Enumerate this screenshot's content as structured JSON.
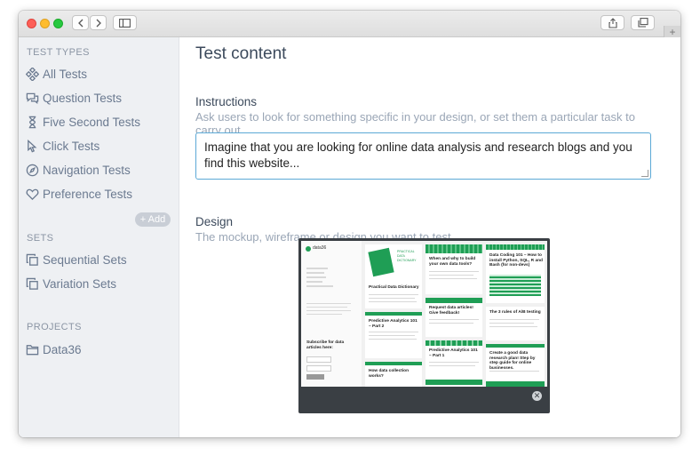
{
  "sidebar": {
    "test_types_title": "TEST TYPES",
    "items": [
      {
        "label": "All Tests",
        "icon": "network-icon"
      },
      {
        "label": "Question Tests",
        "icon": "speech-bubbles-icon"
      },
      {
        "label": "Five Second Tests",
        "icon": "hourglass-icon"
      },
      {
        "label": "Click Tests",
        "icon": "cursor-icon"
      },
      {
        "label": "Navigation Tests",
        "icon": "compass-icon"
      },
      {
        "label": "Preference Tests",
        "icon": "heart-icon"
      }
    ],
    "sets_title": "SETS",
    "add_label": "+ Add",
    "sets": [
      {
        "label": "Sequential Sets",
        "icon": "copy-icon"
      },
      {
        "label": "Variation Sets",
        "icon": "copy-icon"
      }
    ],
    "projects_title": "PROJECTS",
    "projects": [
      {
        "label": "Data36",
        "icon": "folder-icon"
      }
    ]
  },
  "main": {
    "title": "Test content",
    "instructions_label": "Instructions",
    "instructions_hint": "Ask users to look for something specific in your design, or set them a particular task to carry out.",
    "instructions_value": "Imagine that you are looking for online data analysis and research blogs and you find this website...",
    "design_label": "Design",
    "design_hint": "The mockup, wireframe or design you want to test.",
    "design_close": "✕"
  },
  "design_preview": {
    "brand": "data36",
    "sidebar_links": [
      "BLOG",
      "ABOUT ME",
      "CONTACT",
      "BLOG",
      "DOWNLOADS",
      "TAGS"
    ],
    "subscribe_title": "Subscribe for data articles here:",
    "card_titles": [
      "Practical Data Dictionary",
      "When and why to build your own data tools?",
      "Data Coding 101 – How to install Python, SQL, R and Bash (for non-devs)",
      "Predictive Analytics 101 – Part 2",
      "Request data articles! Give feedback!",
      "The 3 rules of A/B testing",
      "How data collection works?",
      "Predictive Analytics 101 – Part 1",
      "Create a good data research plan! Step by step guide for online businesses."
    ],
    "accent": "#1f9e55"
  },
  "colors": {
    "accent": "#5ca9d6",
    "sidebar_bg": "#eef0f3",
    "muted_text": "#8b95a4"
  }
}
